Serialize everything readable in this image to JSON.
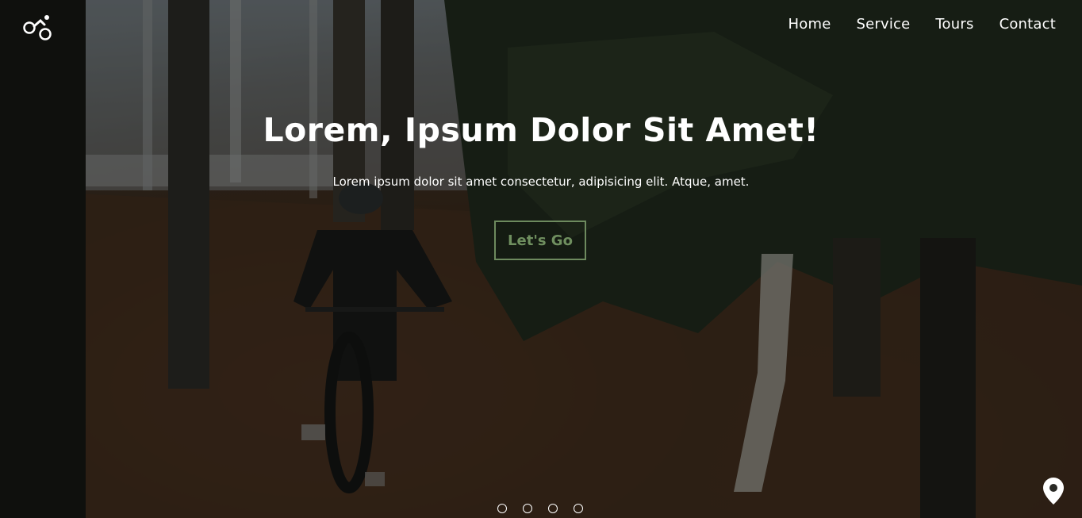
{
  "logo": {
    "icon": "cyclist-icon"
  },
  "nav": {
    "items": [
      {
        "label": "Home"
      },
      {
        "label": "Service"
      },
      {
        "label": "Tours"
      },
      {
        "label": "Contact"
      }
    ]
  },
  "hero": {
    "title": "Lorem, Ipsum Dolor Sit Amet!",
    "subtitle": "Lorem ipsum dolor sit amet consectetur, adipisicing elit. Atque, amet.",
    "cta_label": "Let's Go",
    "background": "mountain-biker-forest-photo"
  },
  "carousel": {
    "slides": 4
  },
  "location_button": {
    "icon": "map-pin-icon"
  },
  "colors": {
    "text": "#ffffff",
    "accent": "#6d8a5e"
  }
}
